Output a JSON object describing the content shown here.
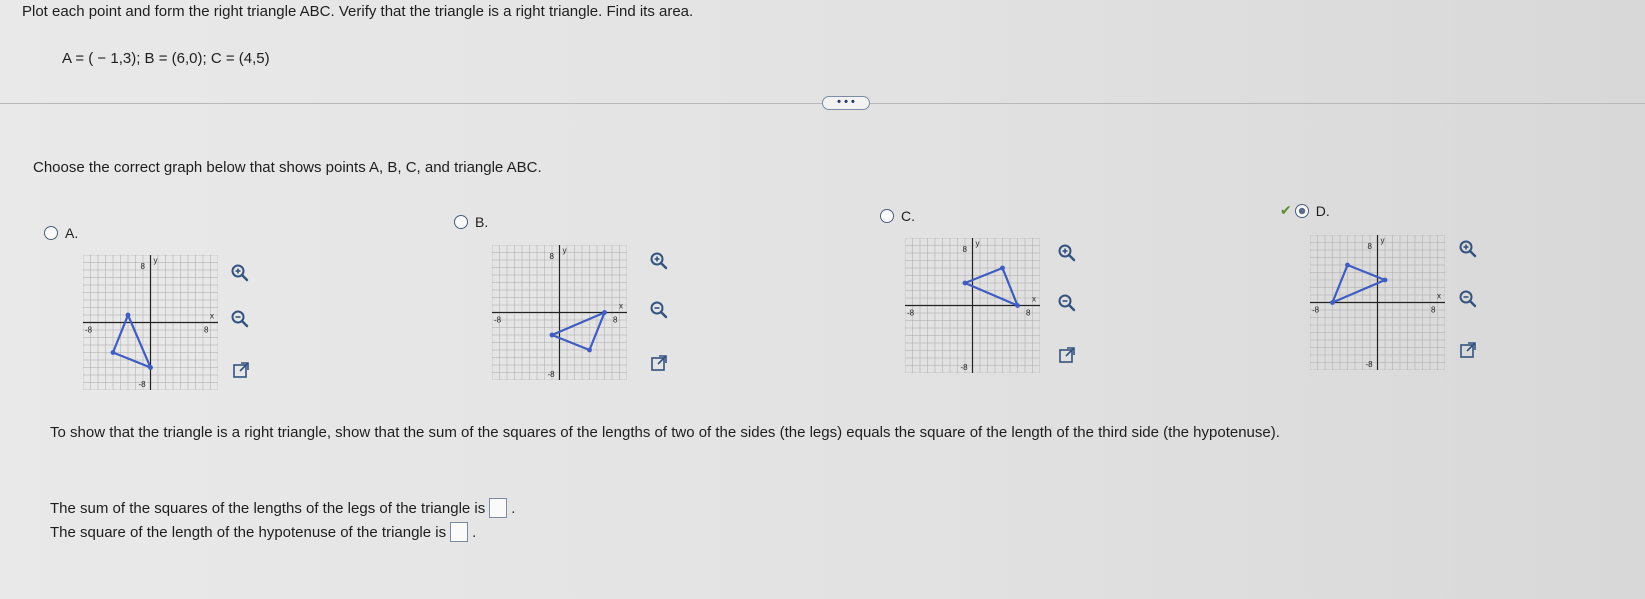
{
  "question": "Plot each point and form the right triangle ABC. Verify that the triangle is a right triangle. Find its area.",
  "points": "A = ( − 1,3);   B = (6,0);   C = (4,5)",
  "more_button": "• • •",
  "prompt": "Choose the correct graph below that shows points A, B, C, and triangle ABC.",
  "options": [
    {
      "label": "A.",
      "selected": false,
      "axis": {
        "y": "y",
        "x": "x",
        "ytop": "8",
        "xleft": "-8",
        "xright": "8",
        "ybottom": "-8"
      }
    },
    {
      "label": "B.",
      "selected": false,
      "axis": {
        "y": "y",
        "x": "x",
        "ytop": "8",
        "xleft": "-8",
        "xright": "8",
        "ybottom": "-8"
      }
    },
    {
      "label": "C.",
      "selected": false,
      "axis": {
        "y": "y",
        "x": "x",
        "ytop": "8",
        "xleft": "-8",
        "xright": "8",
        "ybottom": "-8"
      }
    },
    {
      "label": "D.",
      "selected": true,
      "axis": {
        "y": "y",
        "x": "x",
        "ytop": "8",
        "xleft": "-8",
        "xright": "8",
        "ybottom": "-8"
      }
    }
  ],
  "explanation": "To show that the triangle is a right triangle, show that the sum of the squares of the lengths of two of the sides (the legs) equals the square of the length of the third side (the hypotenuse).",
  "legs_sentence": "The sum of the squares of the lengths of the legs of the triangle is",
  "hyp_sentence": "The square of the length of the hypotenuse of the triangle is",
  "legs_value": "",
  "hyp_value": "",
  "colors": {
    "triangle": "#3f5cc2",
    "axis": "#222222",
    "grid": "#a9a9a9",
    "check": "#5d8f2f"
  },
  "icons": [
    "zoom-in-icon",
    "zoom-out-icon",
    "external-link-icon"
  ]
}
